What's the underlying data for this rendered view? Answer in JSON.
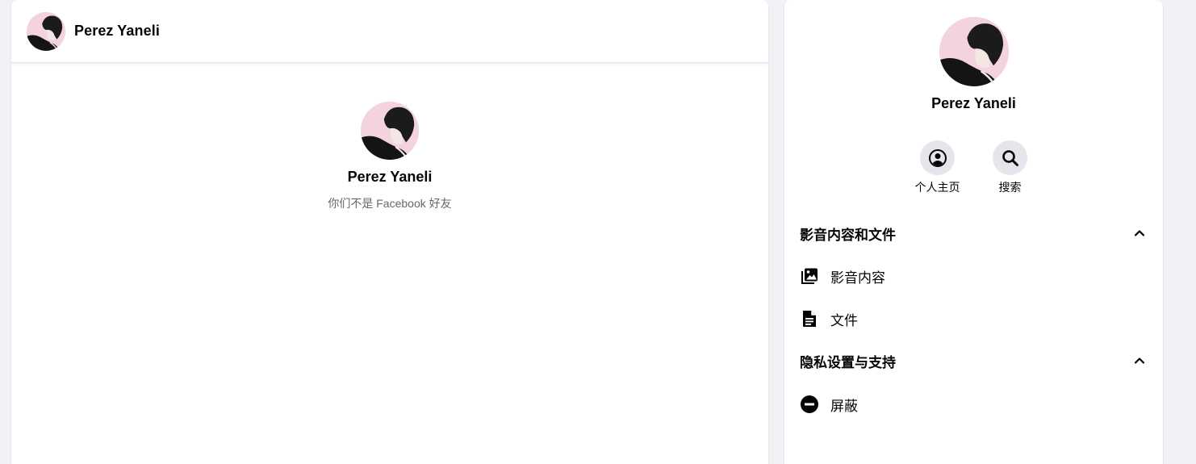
{
  "chat": {
    "header_name": "Perez Yaneli",
    "intro_name": "Perez Yaneli",
    "intro_status": "你们不是 Facebook 好友"
  },
  "info": {
    "name": "Perez Yaneli",
    "actions": [
      {
        "label": "个人主页",
        "icon": "profile-icon"
      },
      {
        "label": "搜索",
        "icon": "search-icon"
      }
    ],
    "sections": [
      {
        "title": "影音内容和文件",
        "expanded": true,
        "items": [
          {
            "label": "影音内容",
            "icon": "media-icon"
          },
          {
            "label": "文件",
            "icon": "file-icon"
          }
        ]
      },
      {
        "title": "隐私设置与支持",
        "expanded": true,
        "items": [
          {
            "label": "屏蔽",
            "icon": "block-icon"
          }
        ]
      }
    ]
  },
  "colors": {
    "page_background": "#f0f2f5",
    "panel_background": "#ffffff",
    "secondary_text": "#65676b",
    "action_circle": "#e4e6eb"
  }
}
